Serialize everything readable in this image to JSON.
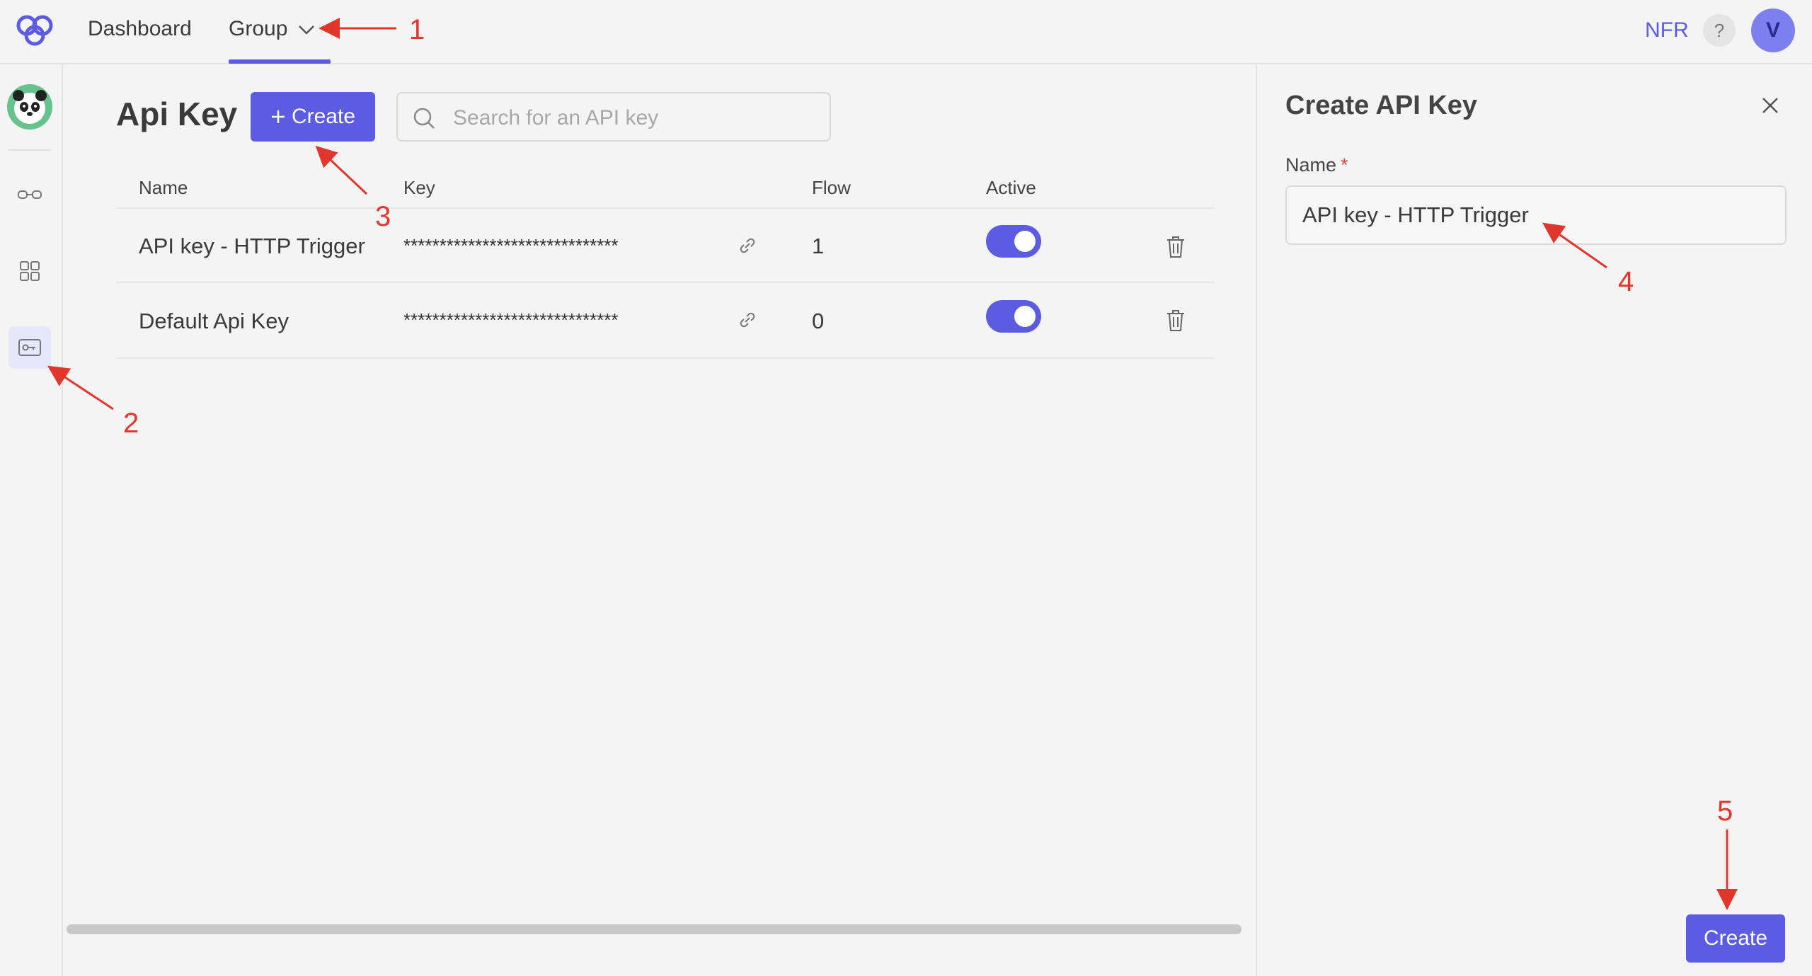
{
  "topbar": {
    "nav_dashboard": "Dashboard",
    "nav_group": "Group",
    "org_label": "NFR",
    "help_label": "?",
    "user_initial": "V"
  },
  "main": {
    "title": "Api Key",
    "create_button": "Create",
    "search_placeholder": "Search for an API key",
    "columns": [
      "Name",
      "Key",
      "Flow",
      "Active"
    ],
    "rows": [
      {
        "name": "API key - HTTP Trigger",
        "key": "******************************",
        "flow": "1",
        "active": true
      },
      {
        "name": "Default Api Key",
        "key": "******************************",
        "flow": "0",
        "active": true
      }
    ]
  },
  "panel": {
    "title": "Create API Key",
    "name_label": "Name",
    "required_mark": "*",
    "name_value": "API key - HTTP Trigger",
    "submit_button": "Create"
  },
  "annotations": [
    "1",
    "2",
    "3",
    "4",
    "5"
  ],
  "colors": {
    "accent": "#5b5ce2",
    "annotation": "#e0362c"
  }
}
